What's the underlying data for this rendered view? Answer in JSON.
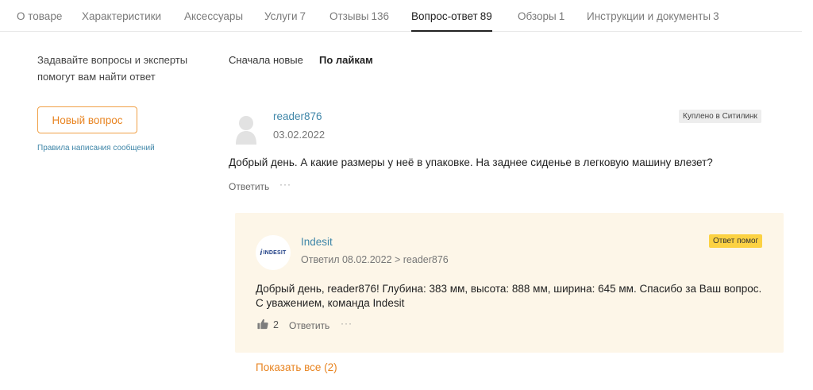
{
  "tabs": [
    {
      "label": "О товаре",
      "count": ""
    },
    {
      "label": "Характеристики",
      "count": ""
    },
    {
      "label": "Аксессуары",
      "count": ""
    },
    {
      "label": "Услуги",
      "count": "7"
    },
    {
      "label": "Отзывы",
      "count": "136"
    },
    {
      "label": "Вопрос-ответ",
      "count": "89"
    },
    {
      "label": "Обзоры",
      "count": "1"
    },
    {
      "label": "Инструкции и документы",
      "count": "3"
    }
  ],
  "active_tab": "Вопрос-ответ",
  "sidebar": {
    "prompt": "Задавайте вопросы и эксперты помогут вам найти ответ",
    "new_question_button": "Новый вопрос",
    "rules_link": "Правила написания сообщений"
  },
  "sort": {
    "newest_label": "Сначала новые",
    "likes_label": "По лайкам",
    "active": "По лайкам"
  },
  "question": {
    "author": "reader876",
    "date": "03.02.2022",
    "badge": "Куплено в Ситилинк",
    "text": "Добрый день. А какие размеры у неё в упаковке. На заднее сиденье в легковую машину влезет?",
    "reply_label": "Ответить",
    "more_label": "···"
  },
  "answer": {
    "logo_text": "INDESIT",
    "logo_letter": "i",
    "author": "Indesit",
    "meta": "Ответил 08.02.2022 > reader876",
    "badge": "Ответ помог",
    "text": "Добрый день, reader876! Глубина: 383 мм, высота: 888 мм, ширина: 645 мм. Спасибо за Ваш вопрос. С уважением, команда Indesit",
    "likes": "2",
    "reply_label": "Ответить",
    "more_label": "···"
  },
  "show_all_label": "Показать все (2)",
  "colors": {
    "link_blue": "#3f86a8",
    "accent_orange": "#e8831f",
    "answer_background": "#fdf6e8",
    "helped_badge": "#fcd243",
    "bought_badge": "#ededed"
  },
  "icons": {
    "avatar": "user-avatar-placeholder-icon",
    "like": "thumbs-up-icon",
    "more": "more-dots-icon"
  }
}
